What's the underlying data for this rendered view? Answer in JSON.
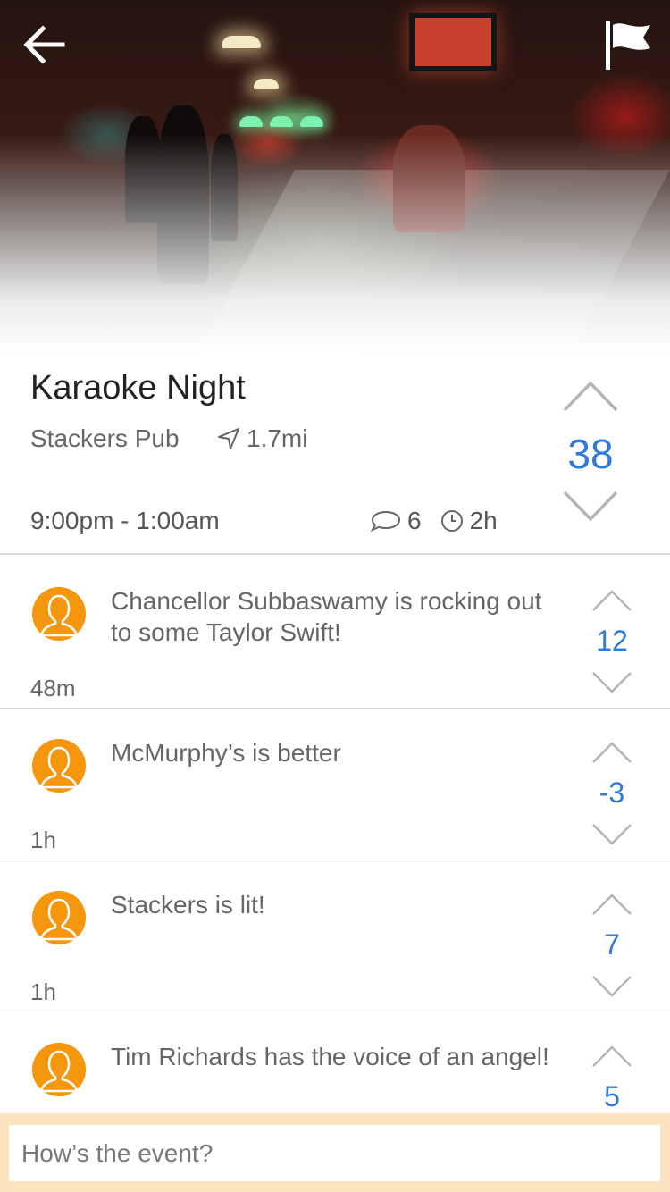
{
  "colors": {
    "accent_blue": "#2f7ad6",
    "avatar_orange": "#f5960c",
    "input_bar_bg": "#fde3bf"
  },
  "header": {
    "back_icon": "arrow-left-icon",
    "flag_icon": "flag-icon"
  },
  "event": {
    "title": "Karaoke Night",
    "venue": "Stackers Pub",
    "distance": "1.7mi",
    "time_range": "9:00pm - 1:00am",
    "comment_count": "6",
    "age": "2h",
    "votes": "38"
  },
  "comments": [
    {
      "text": "Chancellor Subbaswamy is rocking out to some Taylor Swift!",
      "age": "48m",
      "votes": "12"
    },
    {
      "text": "McMurphy’s is better",
      "age": "1h",
      "votes": "-3"
    },
    {
      "text": "Stackers is lit!",
      "age": "1h",
      "votes": "7"
    },
    {
      "text": "Tim Richards has the voice of an angel!",
      "age": "",
      "votes": "5"
    }
  ],
  "composer": {
    "placeholder": "How’s the event?"
  }
}
